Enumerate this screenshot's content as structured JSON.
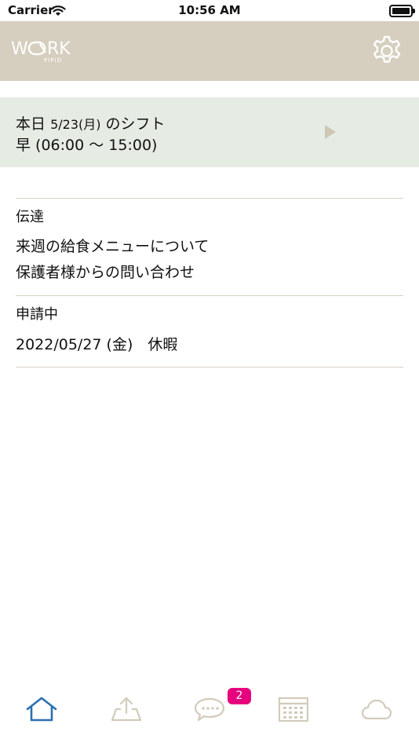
{
  "status_bar": {
    "carrier": "Carrier",
    "time": "10:56 AM"
  },
  "header": {
    "logo_text": "WORK",
    "logo_sub": "PIPIO"
  },
  "shift": {
    "prefix": "本日",
    "date": "5/23(月)",
    "suffix": "のシフト",
    "detail": "早 (06:00 ～ 15:00)"
  },
  "sections": {
    "notices": {
      "title": "伝達",
      "items": [
        "来週の給食メニューについて",
        "保護者様からの問い合わせ"
      ]
    },
    "requests": {
      "title": "申請中",
      "items": [
        "2022/05/27 (金)　休暇"
      ]
    }
  },
  "tabbar": {
    "tabs": [
      {
        "icon": "home-icon",
        "active": true
      },
      {
        "icon": "upload-icon",
        "active": false
      },
      {
        "icon": "chat-icon",
        "active": false
      },
      {
        "icon": "calendar-icon",
        "active": false
      },
      {
        "icon": "cloud-icon",
        "active": false
      }
    ],
    "chat_badge": "2"
  },
  "colors": {
    "header_bg": "#d6cebf",
    "shift_card_bg": "#e6ece3",
    "active_tab": "#2b6fb0",
    "inactive_tab": "#d3cbbb",
    "badge": "#e6007e"
  }
}
